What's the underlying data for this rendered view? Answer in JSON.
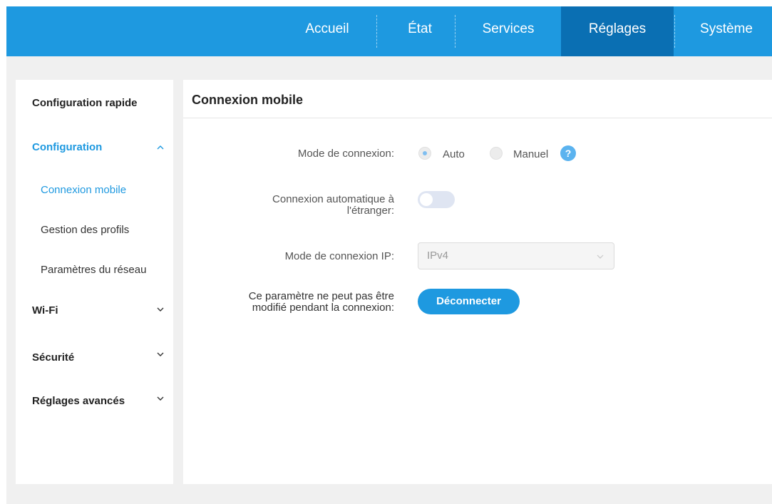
{
  "topnav": {
    "items": [
      {
        "label": "Accueil"
      },
      {
        "label": "État"
      },
      {
        "label": "Services"
      },
      {
        "label": "Réglages"
      },
      {
        "label": "Système"
      }
    ],
    "active": "Réglages"
  },
  "sidebar": {
    "quick_config": "Configuration rapide",
    "configuration": "Configuration",
    "sub_items": [
      {
        "label": "Connexion mobile"
      },
      {
        "label": "Gestion des profils"
      },
      {
        "label": "Paramètres du réseau"
      }
    ],
    "wifi": "Wi-Fi",
    "security": "Sécurité",
    "advanced": "Réglages avancés"
  },
  "main": {
    "title": "Connexion mobile",
    "mode_label": "Mode de connexion:",
    "mode_auto": "Auto",
    "mode_manual": "Manuel",
    "help_symbol": "?",
    "roaming_label_line1": "Connexion automatique à",
    "roaming_label_line2": "l'étranger:",
    "ip_mode_label": "Mode de connexion IP:",
    "ip_mode_value": "IPv4",
    "notice_line1": "Ce paramètre ne peut pas être",
    "notice_line2": "modifié pendant la connexion:",
    "disconnect_label": "Déconnecter"
  },
  "colors": {
    "accent": "#1e99e0",
    "active_nav": "#0a6fb3",
    "page_bg": "#f0f0f0"
  }
}
